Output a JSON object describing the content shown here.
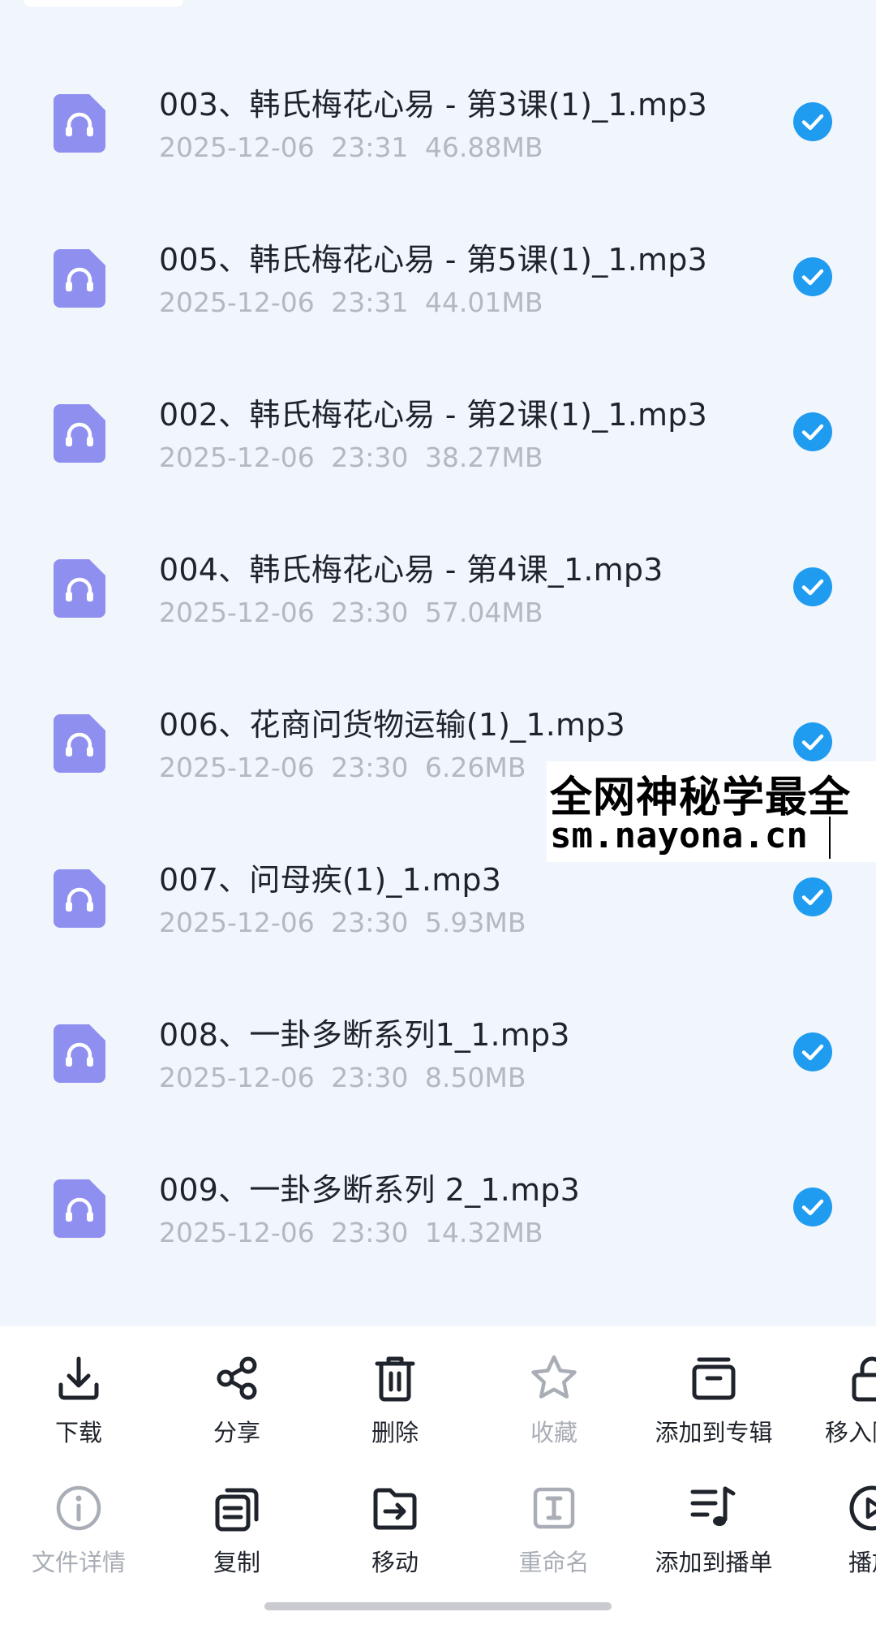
{
  "files": [
    {
      "name": "003、韩氏梅花心易 - 第3课(1)_1.mp3",
      "date": "2025-12-06",
      "time": "23:31",
      "size": "46.88MB",
      "selected": true
    },
    {
      "name": "005、韩氏梅花心易 - 第5课(1)_1.mp3",
      "date": "2025-12-06",
      "time": "23:31",
      "size": "44.01MB",
      "selected": true
    },
    {
      "name": "002、韩氏梅花心易 - 第2课(1)_1.mp3",
      "date": "2025-12-06",
      "time": "23:30",
      "size": "38.27MB",
      "selected": true
    },
    {
      "name": "004、韩氏梅花心易 - 第4课_1.mp3",
      "date": "2025-12-06",
      "time": "23:30",
      "size": "57.04MB",
      "selected": true
    },
    {
      "name": "006、花商问货物运输(1)_1.mp3",
      "date": "2025-12-06",
      "time": "23:30",
      "size": "6.26MB",
      "selected": true
    },
    {
      "name": "007、问母疾(1)_1.mp3",
      "date": "2025-12-06",
      "time": "23:30",
      "size": "5.93MB",
      "selected": true
    },
    {
      "name": "008、一卦多断系列1_1.mp3",
      "date": "2025-12-06",
      "time": "23:30",
      "size": "8.50MB",
      "selected": true
    },
    {
      "name": "009、一卦多断系列 2_1.mp3",
      "date": "2025-12-06",
      "time": "23:30",
      "size": "14.32MB",
      "selected": true
    }
  ],
  "watermark": {
    "line1": "全网神秘学最全",
    "line2": "sm.nayona.cn"
  },
  "actions_row1": [
    {
      "label": "下载",
      "icon": "download-icon",
      "enabled": true
    },
    {
      "label": "分享",
      "icon": "share-icon",
      "enabled": true
    },
    {
      "label": "删除",
      "icon": "trash-icon",
      "enabled": true
    },
    {
      "label": "收藏",
      "icon": "star-icon",
      "enabled": false
    },
    {
      "label": "添加到专辑",
      "icon": "album-icon",
      "enabled": true
    },
    {
      "label": "移入隐藏",
      "icon": "lock-icon",
      "enabled": true
    }
  ],
  "actions_row2": [
    {
      "label": "文件详情",
      "icon": "info-icon",
      "enabled": false
    },
    {
      "label": "复制",
      "icon": "copy-icon",
      "enabled": true
    },
    {
      "label": "移动",
      "icon": "move-icon",
      "enabled": true
    },
    {
      "label": "重命名",
      "icon": "rename-icon",
      "enabled": false
    },
    {
      "label": "添加到播单",
      "icon": "playlist-add-icon",
      "enabled": true
    },
    {
      "label": "播放",
      "icon": "play-icon",
      "enabled": true
    }
  ],
  "colors": {
    "background": "#f1f6fc",
    "icon_purple": "#8f8ff0",
    "check_blue": "#1f9bf0",
    "text_primary": "#1f232b",
    "text_secondary": "#b3b8c2",
    "disabled": "#a9adb5"
  }
}
